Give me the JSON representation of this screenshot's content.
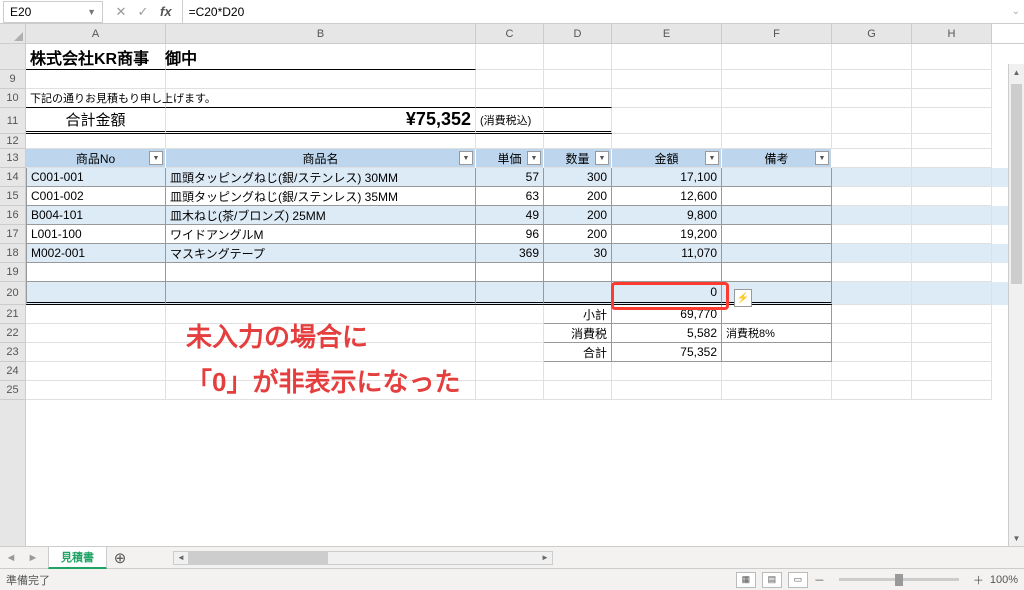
{
  "name_box": "E20",
  "formula": "=C20*D20",
  "columns": [
    "A",
    "B",
    "C",
    "D",
    "E",
    "F",
    "G",
    "H"
  ],
  "row_numbers_before": [
    "9",
    "10"
  ],
  "row_numbers": [
    "11",
    "12",
    "13",
    "14",
    "15",
    "16",
    "17",
    "18",
    "19",
    "20",
    "21",
    "22",
    "23",
    "24",
    "25"
  ],
  "title": "株式会社KR商事　御中",
  "memo": "下記の通りお見積もり申し上げます。",
  "total_label": "合計金額",
  "total_amount": "¥75,352",
  "tax_note": "(消費税込)",
  "headers": [
    "商品No",
    "商品名",
    "単価",
    "数量",
    "金額",
    "備考"
  ],
  "rows": [
    {
      "no": "C001-001",
      "name": "皿頭タッピングねじ(銀/ステンレス) 30MM",
      "price": "57",
      "qty": "300",
      "amount": "17,100",
      "note": ""
    },
    {
      "no": "C001-002",
      "name": "皿頭タッピングねじ(銀/ステンレス) 35MM",
      "price": "63",
      "qty": "200",
      "amount": "12,600",
      "note": ""
    },
    {
      "no": "B004-101",
      "name": "皿木ねじ(茶/ブロンズ) 25MM",
      "price": "49",
      "qty": "200",
      "amount": "9,800",
      "note": ""
    },
    {
      "no": "L001-100",
      "name": "ワイドアングルM",
      "price": "96",
      "qty": "200",
      "amount": "19,200",
      "note": ""
    },
    {
      "no": "M002-001",
      "name": "マスキングテープ",
      "price": "369",
      "qty": "30",
      "amount": "11,070",
      "note": ""
    }
  ],
  "active_value": "0",
  "active_quick": "",
  "subtotal_label": "小計",
  "subtotal_val": "69,770",
  "tax_label": "消費税",
  "tax_val": "5,582",
  "tax_note_f": "消費税8%",
  "grand_label": "合計",
  "grand_val": "75,352",
  "overlay1": "未入力の場合に",
  "overlay2": "「0」が非表示になった",
  "tab_name": "見積書",
  "status": "準備完了",
  "zoom": "100%"
}
